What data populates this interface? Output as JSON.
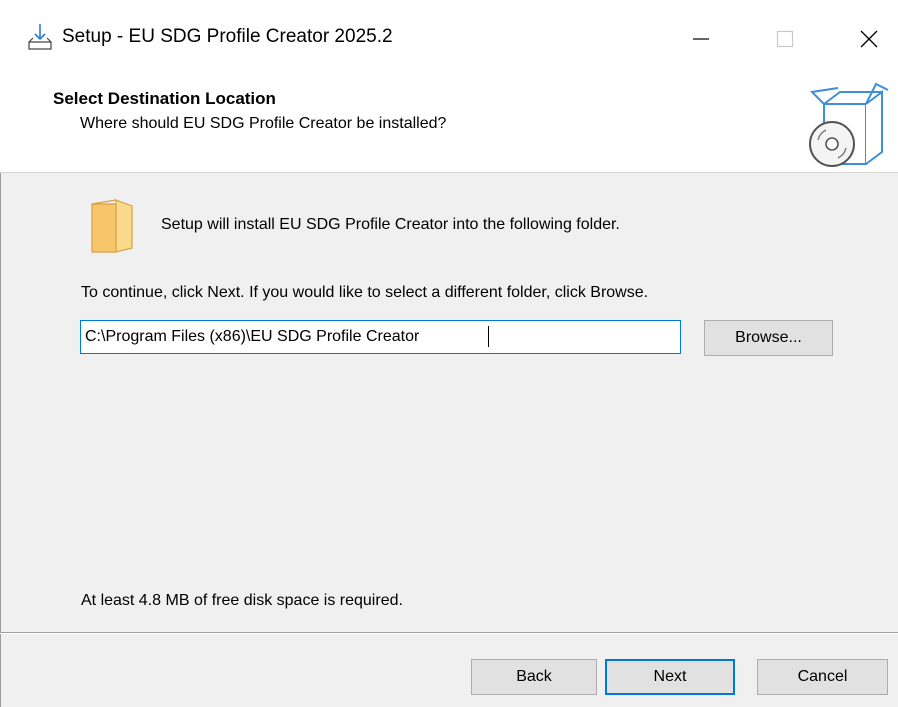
{
  "window": {
    "title": "Setup - EU SDG Profile Creator 2025.2",
    "controls": {
      "minimize": "minimize",
      "maximize": "maximize",
      "close": "close"
    }
  },
  "header": {
    "title": "Select Destination Location",
    "subtitle": "Where should EU SDG Profile Creator be installed?",
    "icon": "software-box-disc-icon"
  },
  "body": {
    "intro_text": "Setup will install EU SDG Profile Creator into the following folder.",
    "instruction_text": "To continue, click Next. If you would like to select a different folder, click Browse.",
    "path_value": "C:\\Program Files (x86)\\EU SDG Profile Creator",
    "browse_label": "Browse...",
    "disk_space_text": "At least 4.8 MB of free disk space is required."
  },
  "footer": {
    "back_label": "Back",
    "next_label": "Next",
    "cancel_label": "Cancel"
  },
  "colors": {
    "accent": "#0078d7",
    "folder": "#f7c66b",
    "box_outline": "#3c8fd8"
  }
}
